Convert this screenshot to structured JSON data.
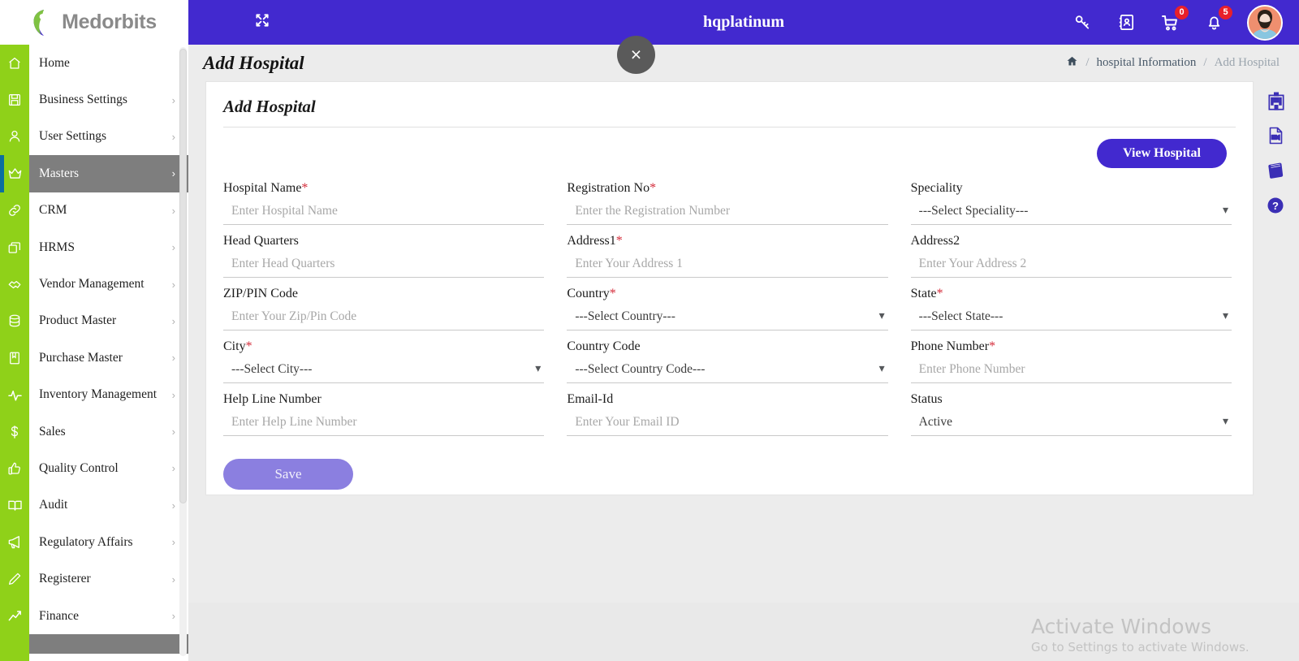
{
  "brand": {
    "name": "Medorbits"
  },
  "topbar": {
    "title": "hqplatinum",
    "menu_icon": "hamburger-icon",
    "expand_icon": "expand-arrows-icon",
    "icons": [
      {
        "name": "key-icon",
        "badge": null
      },
      {
        "name": "contacts-book-icon",
        "badge": null
      },
      {
        "name": "cart-icon",
        "badge": "0"
      },
      {
        "name": "bell-icon",
        "badge": "5"
      }
    ],
    "close_label": "×"
  },
  "sidebar": {
    "items": [
      {
        "label": "Home",
        "icon": "home-icon",
        "chevron": false,
        "active": false
      },
      {
        "label": "Business Settings",
        "icon": "save-icon",
        "chevron": true,
        "active": false
      },
      {
        "label": "User Settings",
        "icon": "user-icon",
        "chevron": true,
        "active": false
      },
      {
        "label": "Masters",
        "icon": "crown-icon",
        "chevron": true,
        "active": true
      },
      {
        "label": "CRM",
        "icon": "link-icon",
        "chevron": true,
        "active": false
      },
      {
        "label": "HRMS",
        "icon": "layers-icon",
        "chevron": true,
        "active": false
      },
      {
        "label": "Vendor Management",
        "icon": "handshake-icon",
        "chevron": true,
        "active": false
      },
      {
        "label": "Product Master",
        "icon": "database-icon",
        "chevron": true,
        "active": false
      },
      {
        "label": "Purchase Master",
        "icon": "book-icon",
        "chevron": true,
        "active": false
      },
      {
        "label": "Inventory Management",
        "icon": "pulse-icon",
        "chevron": true,
        "active": false
      },
      {
        "label": "Sales",
        "icon": "dollar-icon",
        "chevron": true,
        "active": false
      },
      {
        "label": "Quality Control",
        "icon": "thumbs-up-icon",
        "chevron": true,
        "active": false
      },
      {
        "label": "Audit",
        "icon": "open-book-icon",
        "chevron": true,
        "active": false
      },
      {
        "label": "Regulatory Affairs",
        "icon": "megaphone-icon",
        "chevron": true,
        "active": false
      },
      {
        "label": "Registerer",
        "icon": "pencil-icon",
        "chevron": true,
        "active": false
      },
      {
        "label": "Finance",
        "icon": "chart-line-icon",
        "chevron": true,
        "active": false
      }
    ],
    "chevron_glyph": "›"
  },
  "page": {
    "title": "Add Hospital",
    "breadcrumb": {
      "home_icon": "home-icon",
      "sep": "/",
      "parent": "hospital Information",
      "current": "Add Hospital"
    }
  },
  "card": {
    "title": "Add Hospital",
    "view_button": "View Hospital",
    "save_button": "Save"
  },
  "form": {
    "fields": [
      {
        "label": "Hospital Name",
        "required": true,
        "type": "text",
        "placeholder": "Enter Hospital Name",
        "value": ""
      },
      {
        "label": "Registration No",
        "required": true,
        "type": "text",
        "placeholder": "Enter the Registration Number",
        "value": ""
      },
      {
        "label": "Speciality",
        "required": false,
        "type": "select",
        "placeholder": "",
        "value": "---Select Speciality---"
      },
      {
        "label": "Head Quarters",
        "required": false,
        "type": "text",
        "placeholder": "Enter Head Quarters",
        "value": ""
      },
      {
        "label": "Address1",
        "required": true,
        "type": "text",
        "placeholder": "Enter Your Address 1",
        "value": ""
      },
      {
        "label": "Address2",
        "required": false,
        "type": "text",
        "placeholder": "Enter Your Address 2",
        "value": ""
      },
      {
        "label": "ZIP/PIN Code",
        "required": false,
        "type": "text",
        "placeholder": "Enter Your Zip/Pin Code",
        "value": ""
      },
      {
        "label": "Country",
        "required": true,
        "type": "select",
        "placeholder": "",
        "value": "---Select Country---"
      },
      {
        "label": "State",
        "required": true,
        "type": "select",
        "placeholder": "",
        "value": "---Select State---"
      },
      {
        "label": "City",
        "required": true,
        "type": "select",
        "placeholder": "",
        "value": "---Select City---"
      },
      {
        "label": "Country Code",
        "required": false,
        "type": "select",
        "placeholder": "",
        "value": "---Select Country Code---"
      },
      {
        "label": "Phone Number",
        "required": true,
        "type": "text",
        "placeholder": "Enter Phone Number",
        "value": ""
      },
      {
        "label": "Help Line Number",
        "required": false,
        "type": "text",
        "placeholder": "Enter Help Line Number",
        "value": ""
      },
      {
        "label": "Email-Id",
        "required": false,
        "type": "text",
        "placeholder": "Enter Your Email ID",
        "value": ""
      },
      {
        "label": "Status",
        "required": false,
        "type": "select",
        "placeholder": "",
        "value": "Active"
      }
    ]
  },
  "right_rail": [
    {
      "name": "hospital-building-icon"
    },
    {
      "name": "video-file-icon"
    },
    {
      "name": "book-icon"
    },
    {
      "name": "help-circle-icon"
    }
  ],
  "watermark": {
    "line1": "Activate Windows",
    "line2": "Go to Settings to activate Windows."
  },
  "colors": {
    "primary": "#4229CF",
    "sidebar_green": "#8FD119",
    "active_nav": "#7E7E7E",
    "badge_red": "#E8202A",
    "save_purple": "#8B7FE0",
    "required_red": "#D42C3A"
  }
}
